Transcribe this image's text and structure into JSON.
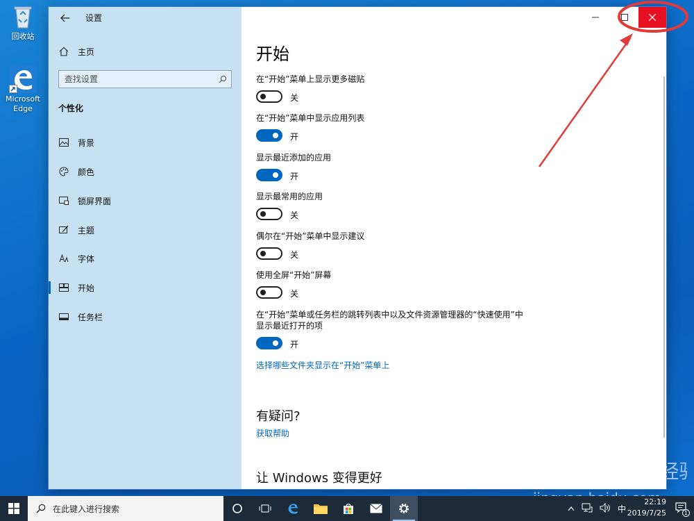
{
  "desktop": {
    "icons": [
      {
        "label": "回收站",
        "icon": "recycle-bin-icon"
      },
      {
        "label": "Microsoft Edge",
        "icon": "edge-icon"
      }
    ]
  },
  "window": {
    "title": "设置",
    "sidebar": {
      "home_label": "主页",
      "search_placeholder": "查找设置",
      "section_title": "个性化",
      "items": [
        {
          "label": "背景",
          "icon": "image-icon"
        },
        {
          "label": "颜色",
          "icon": "palette-icon"
        },
        {
          "label": "锁屏界面",
          "icon": "lock-screen-icon"
        },
        {
          "label": "主题",
          "icon": "theme-brush-icon"
        },
        {
          "label": "字体",
          "icon": "font-icon"
        },
        {
          "label": "开始",
          "icon": "start-tiles-icon",
          "active": true
        },
        {
          "label": "任务栏",
          "icon": "taskbar-icon"
        }
      ]
    },
    "content": {
      "page_title": "开始",
      "settings": [
        {
          "label": "在“开始”菜单上显示更多磁贴",
          "on": false,
          "state_label": "关"
        },
        {
          "label": "在“开始”菜单中显示应用列表",
          "on": true,
          "state_label": "开"
        },
        {
          "label": "显示最近添加的应用",
          "on": true,
          "state_label": "开"
        },
        {
          "label": "显示最常用的应用",
          "on": false,
          "state_label": "关"
        },
        {
          "label": "偶尔在“开始”菜单中显示建议",
          "on": false,
          "state_label": "关"
        },
        {
          "label": "使用全屏“开始”屏幕",
          "on": false,
          "state_label": "关"
        },
        {
          "label": "在“开始”菜单或任务栏的跳转列表中以及文件资源管理器的“快速使用”中显示最近打开的项",
          "on": true,
          "state_label": "开"
        }
      ],
      "folders_link": "选择哪些文件夹显示在“开始”菜单上",
      "question_heading": "有疑问?",
      "help_link": "获取帮助",
      "improve_heading": "让 Windows 变得更好"
    }
  },
  "taskbar": {
    "search_placeholder": "在此键入进行搜索",
    "ime": "中",
    "time": "22:19",
    "date": "2019/7/25",
    "notification_count": "1"
  },
  "watermark": {
    "text": "Bai du 经验",
    "url": "jingyan.baidu.com"
  },
  "colors": {
    "accent": "#0067c0",
    "close_button": "#e81123",
    "sidebar_bg": "#c6e1f2",
    "annotation": "#e03a3a"
  }
}
